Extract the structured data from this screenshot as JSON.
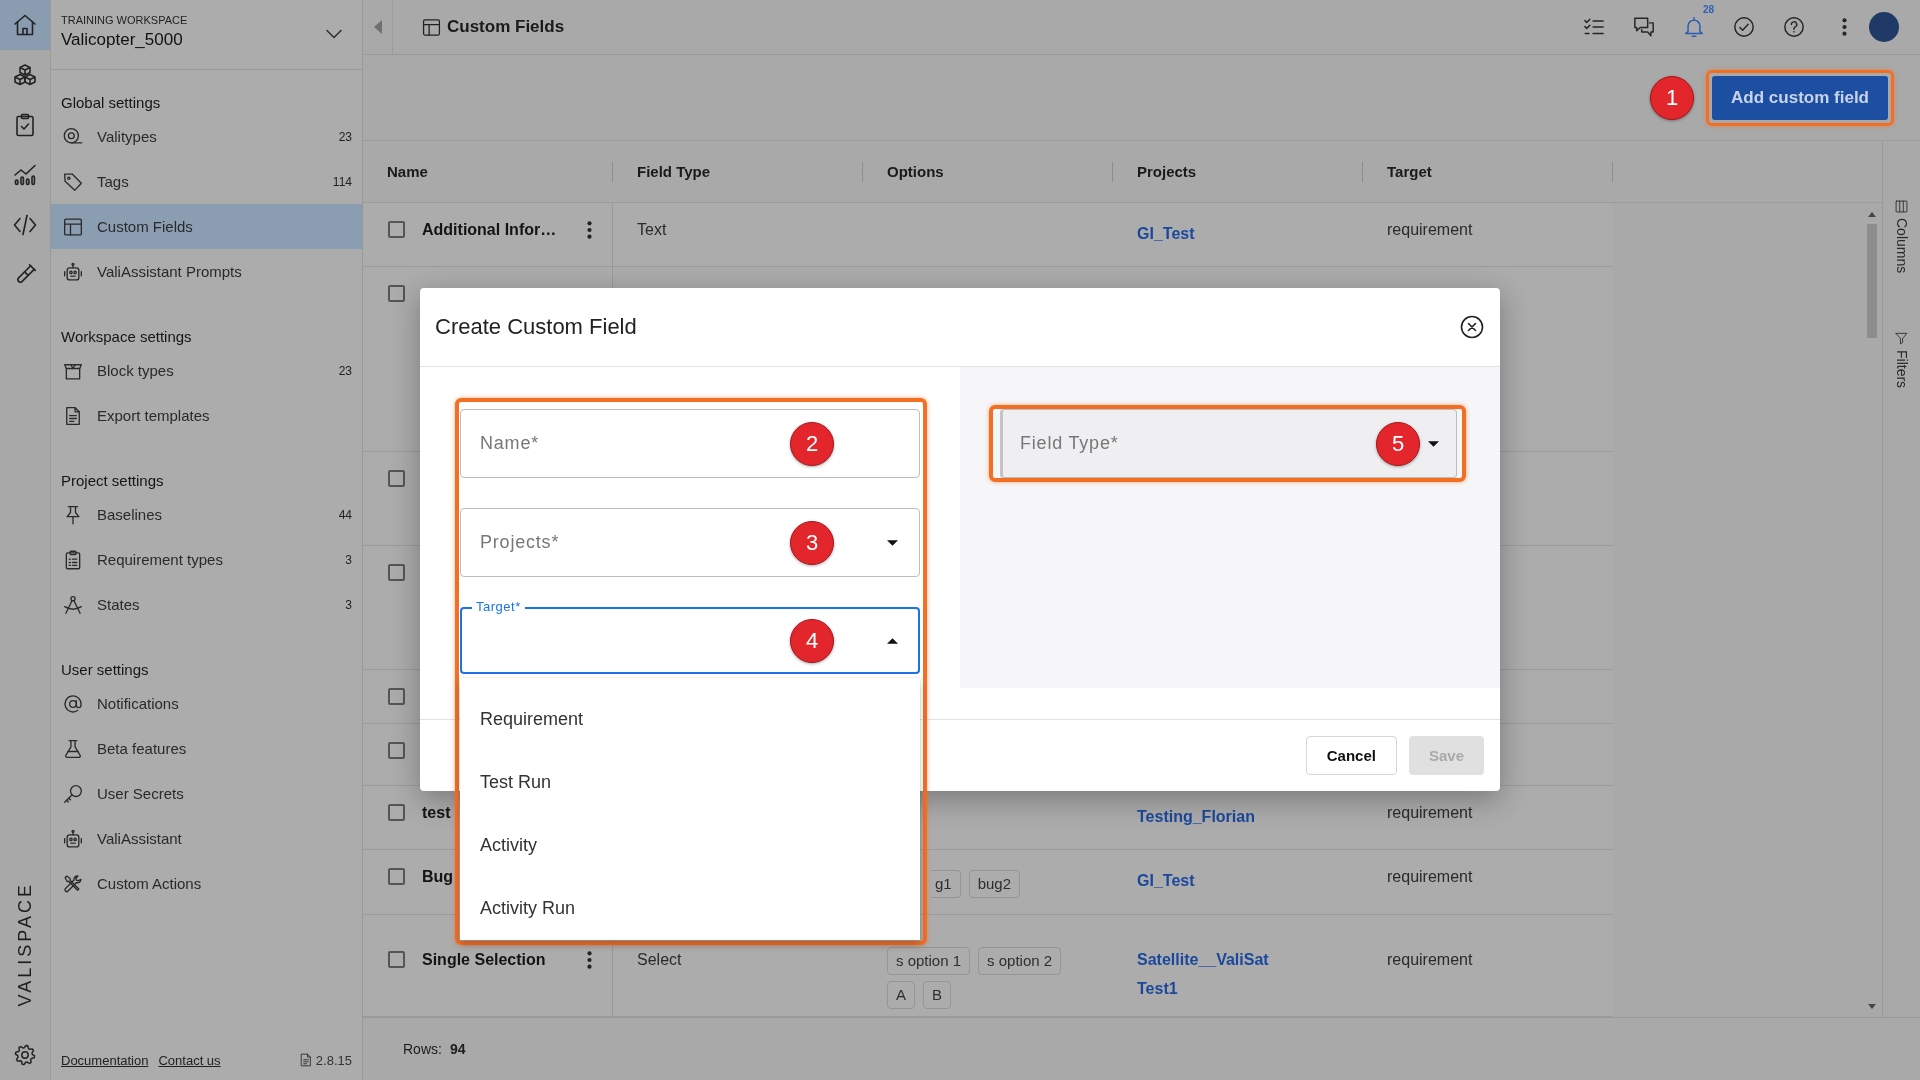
{
  "rail": {
    "items": [
      {
        "kind": "home",
        "selected": true
      },
      {
        "kind": "cubes",
        "selected": false
      },
      {
        "kind": "clipboard",
        "selected": false
      },
      {
        "kind": "chart",
        "selected": false
      },
      {
        "kind": "code",
        "selected": false
      },
      {
        "kind": "tube",
        "selected": false
      }
    ],
    "logo": "VALISPACE"
  },
  "sidebar": {
    "caption": "TRAINING WORKSPACE",
    "workspace": "Valicopter_5000",
    "sections": [
      {
        "title": "Global settings",
        "items": [
          {
            "kind": "target",
            "label": "Valitypes",
            "count": "23",
            "selected": false
          },
          {
            "kind": "tag",
            "label": "Tags",
            "count": "114",
            "selected": false
          },
          {
            "kind": "layout",
            "label": "Custom Fields",
            "selected": true
          },
          {
            "kind": "robot",
            "label": "ValiAssistant Prompts",
            "selected": false
          }
        ]
      },
      {
        "title": "Workspace settings",
        "items": [
          {
            "kind": "box",
            "label": "Block types",
            "count": "23",
            "selected": false
          },
          {
            "kind": "document",
            "label": "Export templates",
            "selected": false
          }
        ]
      },
      {
        "title": "Project settings",
        "items": [
          {
            "kind": "pin",
            "label": "Baselines",
            "count": "44",
            "selected": false
          },
          {
            "kind": "list",
            "label": "Requirement types",
            "count": "3",
            "selected": false
          },
          {
            "kind": "compass",
            "label": "States",
            "count": "3",
            "selected": false
          }
        ]
      },
      {
        "title": "User settings",
        "items": [
          {
            "kind": "at",
            "label": "Notifications",
            "selected": false
          },
          {
            "kind": "flask",
            "label": "Beta features",
            "selected": false
          },
          {
            "kind": "key",
            "label": "User Secrets",
            "selected": false
          },
          {
            "kind": "robot",
            "label": "ValiAssistant",
            "selected": false
          },
          {
            "kind": "tools",
            "label": "Custom Actions",
            "selected": false
          }
        ]
      }
    ],
    "footer": {
      "links": [
        "Documentation",
        "Contact us"
      ],
      "version": "2.8.15"
    }
  },
  "topbar": {
    "title": "Custom Fields",
    "actions": [
      {
        "kind": "checklist"
      },
      {
        "kind": "chat"
      },
      {
        "kind": "bell",
        "badge": "28"
      },
      {
        "kind": "verified"
      },
      {
        "kind": "help"
      },
      {
        "kind": "more"
      },
      {
        "kind": "avatar"
      }
    ]
  },
  "toolbar": {
    "button": {
      "label": "Add custom field",
      "step": "1",
      "highlighted": true
    }
  },
  "table": {
    "columns": [
      "Name",
      "Field Type",
      "Options",
      "Projects",
      "Target"
    ],
    "rows": [
      {
        "checked": false,
        "name": "Additional Infor…",
        "actions_menu": true,
        "field_type": "Text",
        "projects": [
          "GI_Test"
        ],
        "target": "requirement"
      },
      {
        "checked": false
      },
      {
        "checked": false
      },
      {
        "checked": false
      },
      {
        "checked": false
      },
      {
        "checked": false
      },
      {
        "checked": false,
        "name": "test",
        "projects": [
          "Testing_Florian"
        ],
        "target": "requirement"
      },
      {
        "checked": false,
        "name": "Bug",
        "options": [
          {
            "label": "g1",
            "cut": true
          },
          {
            "label": "bug2",
            "cut": false
          }
        ],
        "projects": [
          "GI_Test"
        ],
        "target": "requirement"
      },
      {
        "checked": false,
        "name": "Single Selection",
        "actions_menu": true,
        "field_type": "Select",
        "options": [
          {
            "label": "s option 1",
            "cut": false
          },
          {
            "label": "s option 2",
            "cut": false
          },
          {
            "label": "A",
            "cut": false
          },
          {
            "label": "B",
            "cut": false
          }
        ],
        "projects": [
          "Satellite__ValiSat",
          "Test1"
        ],
        "target": "requirement"
      }
    ]
  },
  "side_tabs": [
    {
      "kind": "columns",
      "label": "Columns"
    },
    {
      "kind": "filter",
      "label": "Filters"
    }
  ],
  "status_bar": {
    "label": "Rows:",
    "count": "94"
  },
  "modal": {
    "title": "Create Custom Field",
    "form": {
      "highlighted": true,
      "fields": [
        {
          "kind": "text",
          "label": "Name*",
          "step": "2",
          "focused": false
        },
        {
          "kind": "select",
          "label": "Projects*",
          "step": "3",
          "focused": false,
          "expanded": false
        },
        {
          "kind": "select",
          "label": "Target*",
          "step": "4",
          "focused": true,
          "expanded": true
        }
      ],
      "menu": [
        {
          "label": "Requirement",
          "selected": false
        },
        {
          "label": "Test Run",
          "selected": false
        },
        {
          "label": "Activity",
          "selected": false
        },
        {
          "label": "Activity Run",
          "selected": false
        }
      ]
    },
    "field_type": {
      "kind": "select",
      "label": "Field Type*",
      "step": "5",
      "focused": false,
      "expanded": false,
      "highlighted": true
    },
    "buttons": [
      {
        "kind": "outlined",
        "label": "Cancel",
        "disabled": false
      },
      {
        "kind": "filled",
        "label": "Save",
        "disabled": true
      }
    ]
  }
}
